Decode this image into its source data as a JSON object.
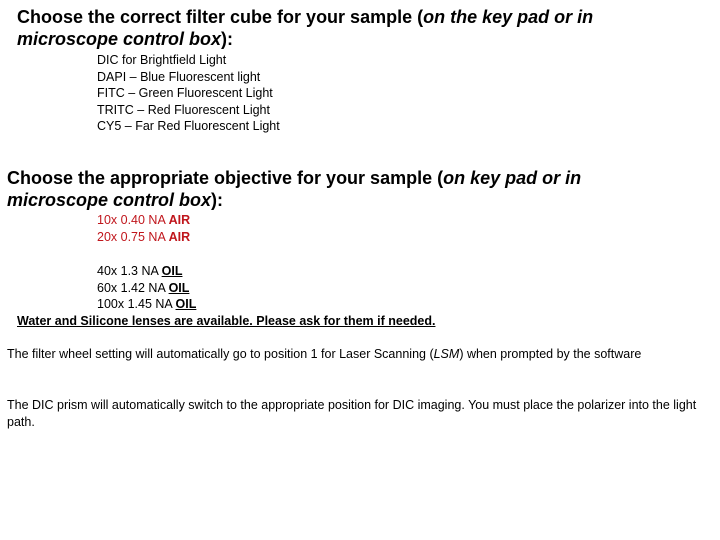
{
  "filter_section": {
    "heading_main": "Choose the correct filter cube for your sample (",
    "heading_italic": "on the key pad or in microscope control box",
    "heading_end": "):",
    "items": [
      "DIC for Brightfield Light",
      "DAPI – Blue Fluorescent light",
      "FITC – Green Fluorescent Light",
      "TRITC – Red Fluorescent Light",
      "CY5 – Far Red Fluorescent Light"
    ]
  },
  "objective_section": {
    "heading_main": "Choose the appropriate objective for your sample (",
    "heading_italic": "on key pad or in microscope control box",
    "heading_end": "):",
    "air_objectives": [
      {
        "label": "10x 0.40 NA ",
        "medium": "AIR"
      },
      {
        "label": "20x 0.75 NA ",
        "medium": "AIR"
      }
    ],
    "oil_objectives": [
      {
        "label": "40x 1.3 NA ",
        "medium": "OIL"
      },
      {
        "label": "60x 1.42 NA ",
        "medium": "OIL"
      },
      {
        "label": "100x 1.45 NA ",
        "medium": "OIL"
      }
    ],
    "note": "Water and Silicone lenses are available. Please ask for them if needed.",
    "air_color": "#c0161c"
  },
  "paragraphs": {
    "filter_wheel_start": "The filter wheel setting will automatically go to position 1 for Laser Scanning (",
    "filter_wheel_italic": "LSM",
    "filter_wheel_end": ") when prompted by the software",
    "dic_prism": "The DIC prism will automatically switch to the appropriate position for DIC imaging. You must place the polarizer into the light path."
  }
}
